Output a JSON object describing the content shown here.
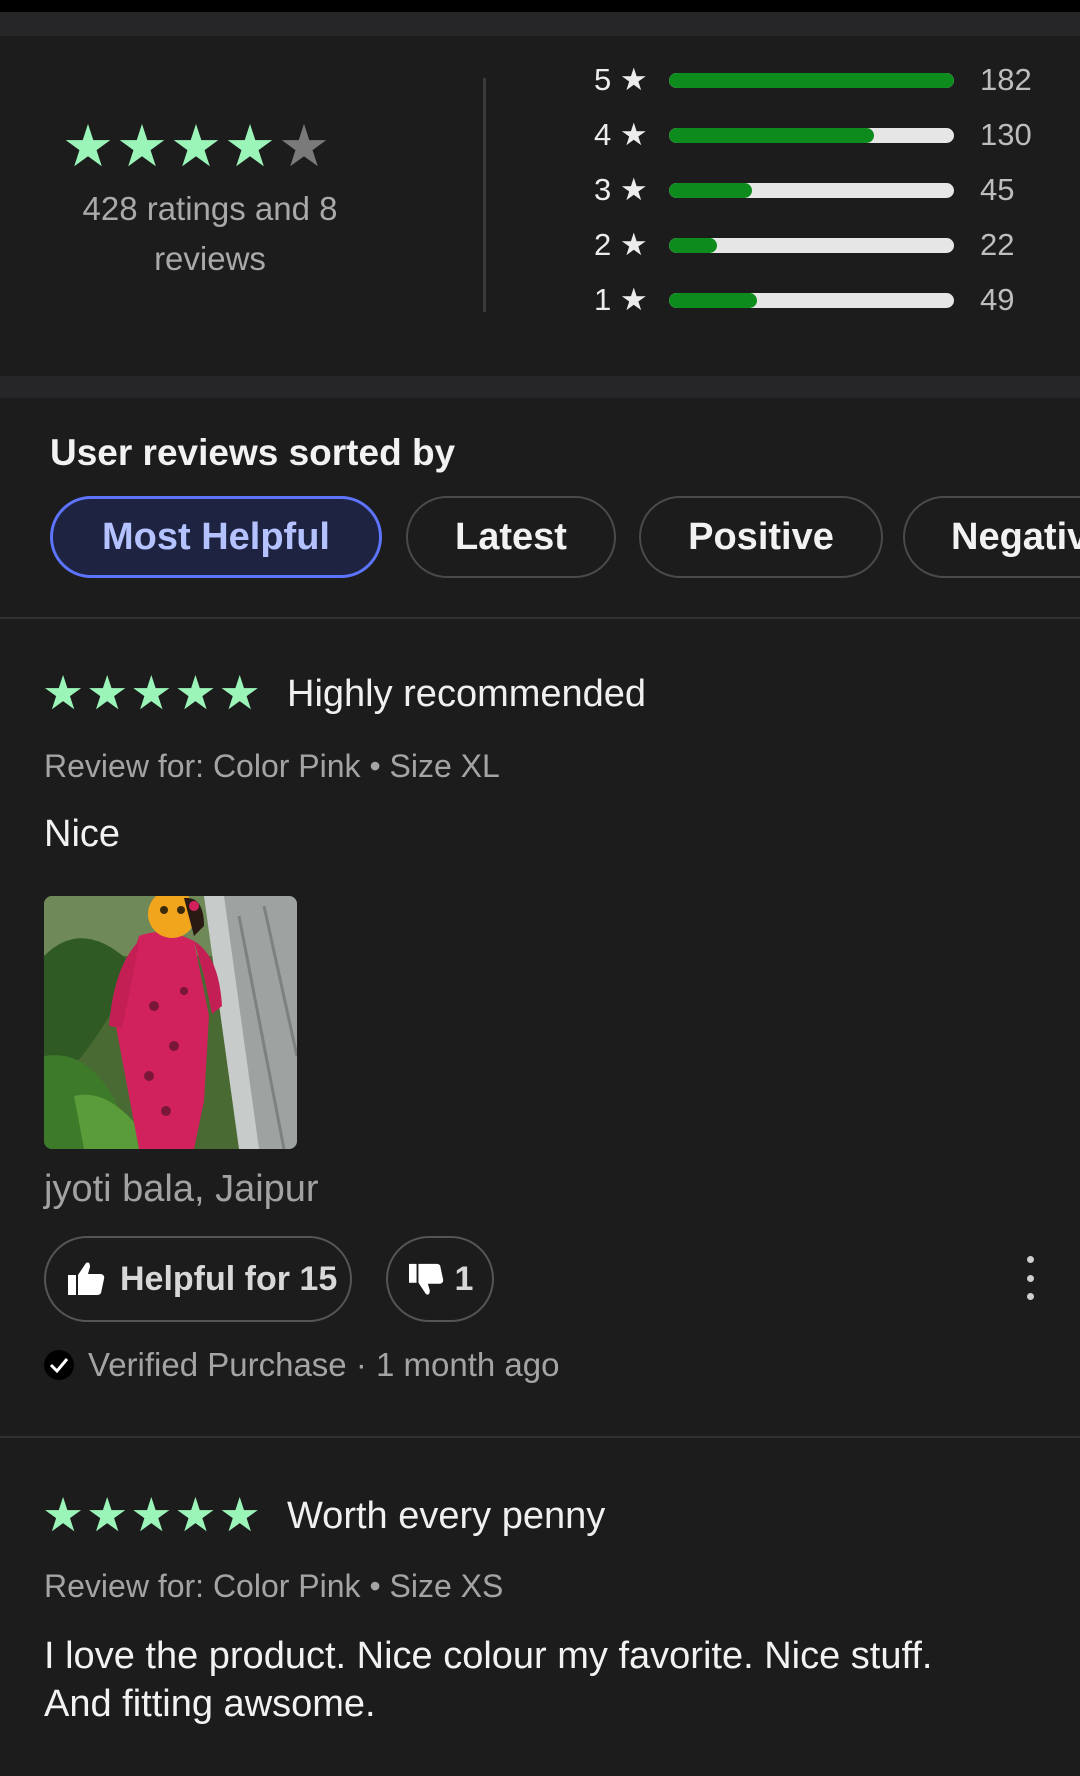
{
  "summary": {
    "stars_filled": 4,
    "stars_total": 5,
    "text": "428 ratings and 8 reviews",
    "rating_rows": [
      {
        "label": "5 ★",
        "count": "182",
        "fraction": 1.0
      },
      {
        "label": "4 ★",
        "count": "130",
        "fraction": 0.72
      },
      {
        "label": "3 ★",
        "count": "45",
        "fraction": 0.29
      },
      {
        "label": "2 ★",
        "count": "22",
        "fraction": 0.17
      },
      {
        "label": "1 ★",
        "count": "49",
        "fraction": 0.31
      }
    ]
  },
  "sort": {
    "title": "User reviews sorted by",
    "chips": [
      "Most Helpful",
      "Latest",
      "Positive",
      "Negative"
    ],
    "active": "Most Helpful"
  },
  "reviews": [
    {
      "stars": 5,
      "title": "Highly recommended",
      "variant": "Review for: Color Pink • Size XL",
      "body": "Nice",
      "author": "jyoti bala, Jaipur",
      "helpful_label": "Helpful for 15",
      "unhelpful_count": "1",
      "verified": "Verified Purchase · 1 month ago"
    },
    {
      "stars": 5,
      "title": "Worth every penny",
      "variant": "Review for: Color Pink • Size XS",
      "body_line1": "I love the product. Nice  colour my favorite.  Nice stuff.",
      "body_line2": "And fitting awsome."
    }
  ],
  "icons": {
    "star": "star-icon",
    "thumbs_up": "thumbs-up-icon",
    "thumbs_down": "thumbs-down-icon",
    "more": "more-vertical-icon",
    "check": "check-icon"
  },
  "colors": {
    "background": "#1c1c1d",
    "star_green": "#9cf5b8",
    "bar_green": "#0d8c1d",
    "chip_active_border": "#5d74ff",
    "chip_active_text": "#b4c3ff"
  }
}
